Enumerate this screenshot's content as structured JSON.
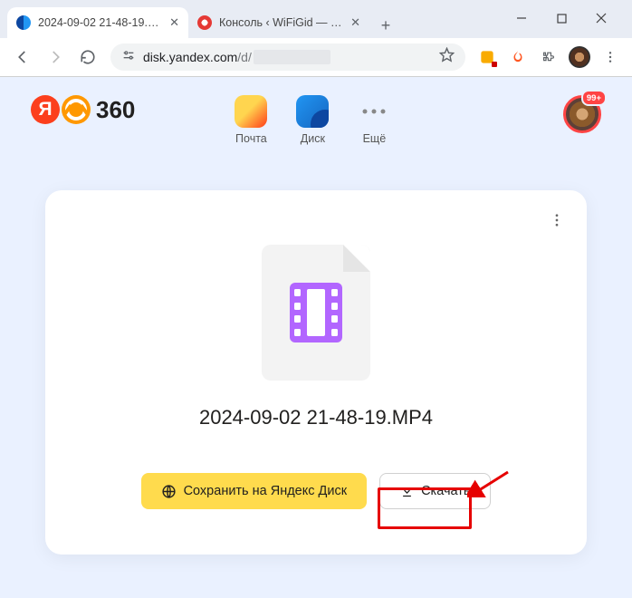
{
  "browser": {
    "tabs": [
      {
        "title": "2024-09-02 21-48-19.MP4 –"
      },
      {
        "title": "Консоль ‹ WiFiGid — WordP"
      }
    ],
    "address": {
      "domain": "disk.yandex.com",
      "path": "/d/"
    }
  },
  "header": {
    "logo_text": "360",
    "services": {
      "mail": "Почта",
      "disk": "Диск",
      "more": "Ещё"
    },
    "notification_count": "99+"
  },
  "card": {
    "filename": "2024-09-02 21-48-19.MP4",
    "save_button": "Сохранить на Яндекс Диск",
    "download_button": "Скачать"
  }
}
